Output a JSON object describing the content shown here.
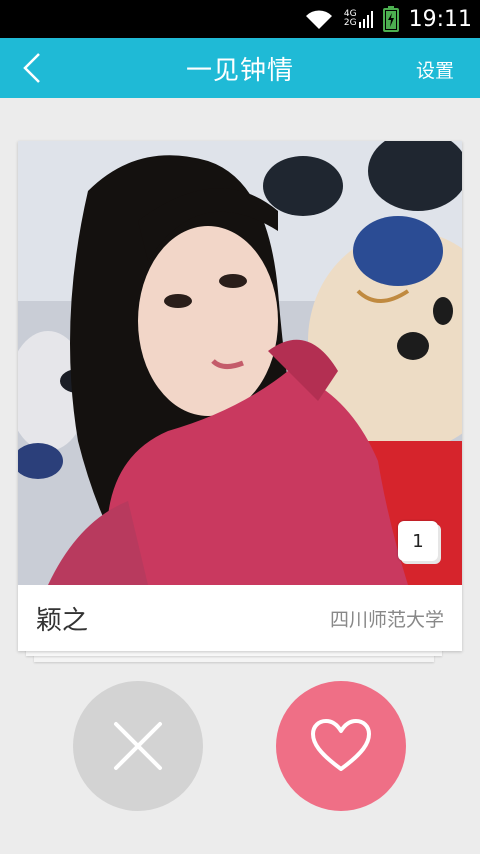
{
  "status_bar": {
    "net_top": "4G",
    "net_bottom": "2G",
    "time": "19:11",
    "icons": [
      "wifi-icon",
      "signal-icon",
      "battery-icon"
    ]
  },
  "app_bar": {
    "title": "一见钟情",
    "settings_label": "设置",
    "back_icon": "chevron-left-icon",
    "color": "#1fbad6"
  },
  "profile": {
    "name": "颖之",
    "school": "四川师范大学",
    "photo_count": "1"
  },
  "actions": {
    "dislike_icon": "close-icon",
    "dislike_color": "#d3d3d3",
    "like_icon": "heart-icon",
    "like_color": "#ef6f86"
  }
}
